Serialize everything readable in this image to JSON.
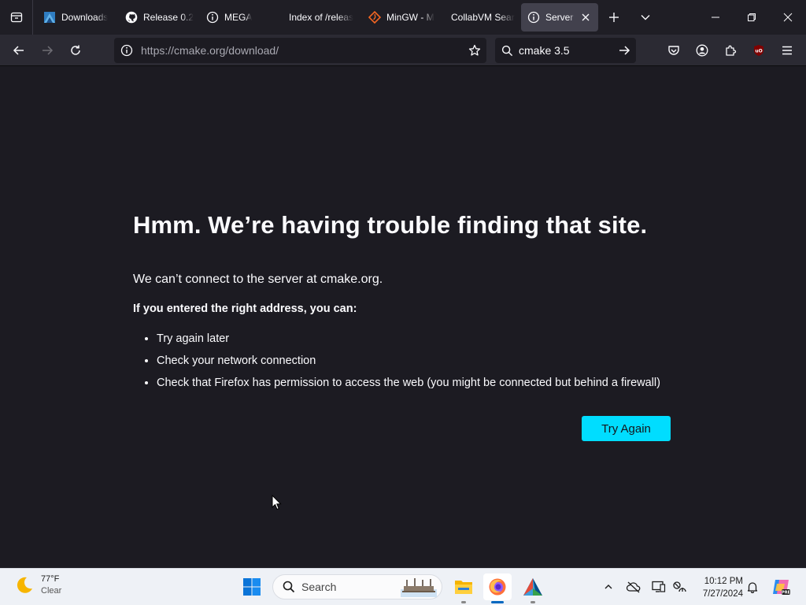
{
  "tabs": [
    {
      "title": "Downloads",
      "icon": "cmake-logo-icon",
      "active": false
    },
    {
      "title": "Release 0.2",
      "icon": "github-icon",
      "active": false
    },
    {
      "title": "MEGA",
      "icon": "info-icon",
      "active": false
    },
    {
      "title": "Index of /releas",
      "icon": "blank-page-icon",
      "active": false
    },
    {
      "title": "MinGW - M",
      "icon": "sourceforge-icon",
      "active": false
    },
    {
      "title": "CollabVM Sear",
      "icon": "blank-page-icon",
      "active": false
    },
    {
      "title": "Server N",
      "icon": "info-icon",
      "active": true
    }
  ],
  "navbar": {
    "url_host": "https://cmake.org",
    "url_path": "/download/",
    "search_value": "cmake 3.5"
  },
  "error_page": {
    "title": "Hmm. We’re having trouble finding that site.",
    "message": "We can’t connect to the server at cmake.org.",
    "suggestion_heading": "If you entered the right address, you can:",
    "suggestions": [
      "Try again later",
      "Check your network connection",
      "Check that Firefox has permission to access the web (you might be connected but behind a firewall)"
    ],
    "retry_label": "Try Again"
  },
  "taskbar": {
    "weather_temp": "77°F",
    "weather_condition": "Clear",
    "search_placeholder": "Search",
    "time": "10:12 PM",
    "date": "7/27/2024"
  },
  "colors": {
    "page_bg": "#1c1b22",
    "accent": "#00ddff",
    "taskbar_bg": "#eef1f6"
  }
}
